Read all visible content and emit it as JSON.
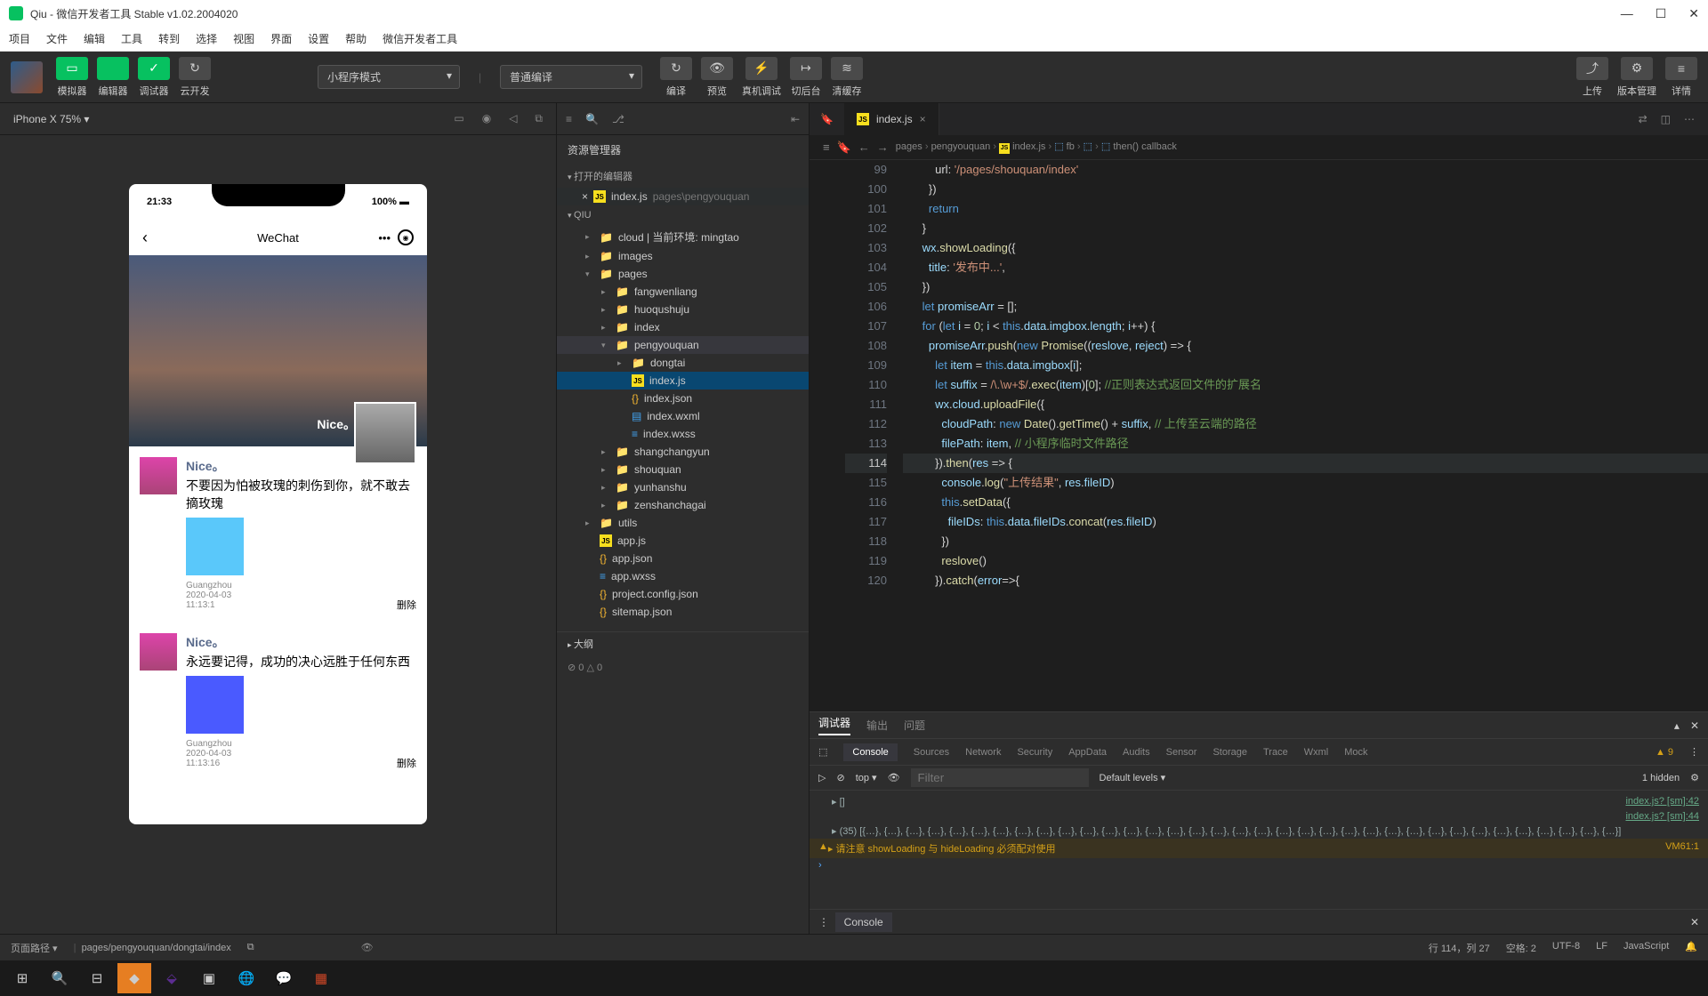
{
  "title": "Qiu - 微信开发者工具 Stable v1.02.2004020",
  "menu": [
    "项目",
    "文件",
    "编辑",
    "工具",
    "转到",
    "选择",
    "视图",
    "界面",
    "设置",
    "帮助",
    "微信开发者工具"
  ],
  "toolbarGroups": {
    "left": [
      {
        "label": "模拟器",
        "icon": "▭",
        "cls": "green"
      },
      {
        "label": "编辑器",
        "icon": "</>",
        "cls": "green"
      },
      {
        "label": "调试器",
        "icon": "✓",
        "cls": "green"
      },
      {
        "label": "云开发",
        "icon": "↻",
        "cls": "gray"
      }
    ],
    "mode": "小程序模式",
    "compile": "普通编译",
    "mid": [
      {
        "label": "编译",
        "icon": "↻"
      },
      {
        "label": "预览",
        "icon": "👁"
      },
      {
        "label": "真机调试",
        "icon": "⚡"
      },
      {
        "label": "切后台",
        "icon": "↦"
      },
      {
        "label": "清缓存",
        "icon": "≋"
      }
    ],
    "right": [
      {
        "label": "上传",
        "icon": "⤴"
      },
      {
        "label": "版本管理",
        "icon": "⚙"
      },
      {
        "label": "详情",
        "icon": "≡"
      }
    ]
  },
  "simHeader": {
    "device": "iPhone X 75% ▾"
  },
  "phone": {
    "time": "21:33",
    "battery": "100%",
    "title": "WeChat",
    "hero": "Nice。",
    "posts": [
      {
        "name": "Nice。",
        "text": "不要因为怕被玫瑰的刺伤到你，就不敢去摘玫瑰",
        "loc": "Guangzhou",
        "date": "2020-04-03",
        "t": "11:13:1",
        "del": "删除",
        "img": "yellow"
      },
      {
        "name": "Nice。",
        "text": "永远要记得，成功的决心远胜于任何东西",
        "loc": "Guangzhou",
        "date": "2020-04-03",
        "t": "11:13:16",
        "del": "删除",
        "img": "blue"
      }
    ]
  },
  "explorer": {
    "title": "资源管理器",
    "openEditors": "打开的编辑器",
    "openFile": {
      "name": "index.js",
      "path": "pages\\pengyouquan"
    },
    "root": "QIU",
    "tree": [
      {
        "d": 1,
        "t": "folder",
        "n": "cloud | 当前环境: mingtao"
      },
      {
        "d": 1,
        "t": "folder",
        "n": "images"
      },
      {
        "d": 1,
        "t": "folder",
        "n": "pages",
        "open": true
      },
      {
        "d": 2,
        "t": "folder",
        "n": "fangwenliang"
      },
      {
        "d": 2,
        "t": "folder",
        "n": "huoqushuju"
      },
      {
        "d": 2,
        "t": "folder",
        "n": "index"
      },
      {
        "d": 2,
        "t": "folder",
        "n": "pengyouquan",
        "open": true,
        "sel": true
      },
      {
        "d": 3,
        "t": "folder",
        "n": "dongtai"
      },
      {
        "d": 3,
        "t": "js",
        "n": "index.js",
        "hl": true
      },
      {
        "d": 3,
        "t": "json",
        "n": "index.json"
      },
      {
        "d": 3,
        "t": "wxml",
        "n": "index.wxml"
      },
      {
        "d": 3,
        "t": "wxss",
        "n": "index.wxss"
      },
      {
        "d": 2,
        "t": "folder",
        "n": "shangchangyun"
      },
      {
        "d": 2,
        "t": "folder",
        "n": "shouquan"
      },
      {
        "d": 2,
        "t": "folder",
        "n": "yunhanshu"
      },
      {
        "d": 2,
        "t": "folder",
        "n": "zenshanchagai"
      },
      {
        "d": 1,
        "t": "folder",
        "n": "utils"
      },
      {
        "d": 1,
        "t": "js",
        "n": "app.js"
      },
      {
        "d": 1,
        "t": "json",
        "n": "app.json"
      },
      {
        "d": 1,
        "t": "wxss",
        "n": "app.wxss"
      },
      {
        "d": 1,
        "t": "json",
        "n": "project.config.json"
      },
      {
        "d": 1,
        "t": "json",
        "n": "sitemap.json"
      }
    ],
    "outline": "大纲",
    "stats": "⊘ 0 △ 0"
  },
  "editor": {
    "tab": "index.js",
    "breadcrumb": [
      "pages",
      "pengyouquan",
      "index.js",
      "fb",
      "<function>",
      "then() callback"
    ],
    "startLine": 99
  },
  "devtools": {
    "tabs": [
      "调试器",
      "输出",
      "问题"
    ],
    "subtabs": [
      "Console",
      "Sources",
      "Network",
      "Security",
      "AppData",
      "Audits",
      "Sensor",
      "Storage",
      "Trace",
      "Wxml",
      "Mock"
    ],
    "warnCount": "9",
    "filterLabel": "top",
    "filterPlaceholder": "Filter",
    "levels": "Default levels ▾",
    "hidden": "1 hidden",
    "lines": [
      {
        "t": "▸ []",
        "r": "index.js? [sm]:42"
      },
      {
        "t": "",
        "r": "index.js? [sm]:44"
      },
      {
        "t": "▸ (35) [{…}, {…}, {…}, {…}, {…}, {…}, {…}, {…}, {…}, {…}, {…}, {…}, {…}, {…}, {…}, {…}, {…}, {…}, {…}, {…}, {…}, {…}, {…}, {…}, {…}, {…}, {…}, {…}, {…}, {…}, {…}, {…}, {…}, {…}, {…}]",
        "r": ""
      }
    ],
    "warn": "▸ 请注意 showLoading 与 hideLoading 必须配对使用",
    "warnR": "VM61:1",
    "footTab": "Console"
  },
  "status": {
    "pathLabel": "页面路径 ▾",
    "path": "pages/pengyouquan/dongtai/index",
    "right": [
      "行 114，列 27",
      "空格: 2",
      "UTF-8",
      "LF",
      "JavaScript"
    ]
  }
}
